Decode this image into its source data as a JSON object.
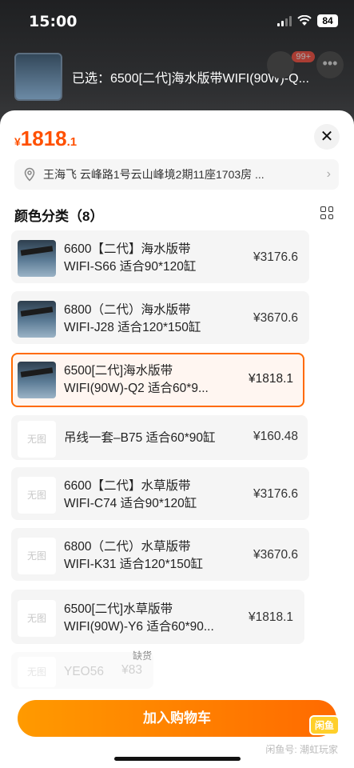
{
  "status": {
    "time": "15:00",
    "battery": "84"
  },
  "header": {
    "selected_text": "已选：6500[二代]海水版带WIFI(90W)-Q...",
    "cart_badge": "99+"
  },
  "sheet": {
    "price": {
      "currency": "¥",
      "integer": "1818",
      "decimal": ".1"
    },
    "close_label": "✕",
    "address": "王海飞 云峰路1号云山峰境2期11座1703房 ...",
    "section_title": "颜色分类（8）",
    "options": [
      {
        "line1": "6600【二代】海水版带",
        "line2": "WIFI-S66 适合90*120缸",
        "price": "¥3176.6",
        "has_image": true
      },
      {
        "line1": "6800（二代）海水版带",
        "line2": "WIFI-J28 适合120*150缸",
        "price": "¥3670.6",
        "has_image": true
      },
      {
        "line1": "6500[二代]海水版带",
        "line2": "WIFI(90W)-Q2 适合60*9...",
        "price": "¥1818.1",
        "has_image": true,
        "selected": true
      },
      {
        "line1": "吊线一套–B75 适合60*90缸",
        "line2": "",
        "price": "¥160.48",
        "has_image": false
      },
      {
        "line1": "6600【二代】水草版带",
        "line2": "WIFI-C74 适合90*120缸",
        "price": "¥3176.6",
        "has_image": false
      },
      {
        "line1": "6800（二代）水草版带",
        "line2": "WIFI-K31 适合120*150缸",
        "price": "¥3670.6",
        "has_image": false
      },
      {
        "line1": "6500[二代]水草版带",
        "line2": "WIFI(90W)-Y6 适合60*90...",
        "price": "¥1818.1",
        "has_image": false
      },
      {
        "line1": "YEO56",
        "line2": "",
        "price": "¥83",
        "has_image": false,
        "soldout": true
      }
    ],
    "no_image_label": "无图",
    "soldout_label": "缺货",
    "add_to_cart": "加入购物车",
    "logo_text": "闲鱼",
    "watermark": "闲鱼号: 潮虹玩家"
  }
}
